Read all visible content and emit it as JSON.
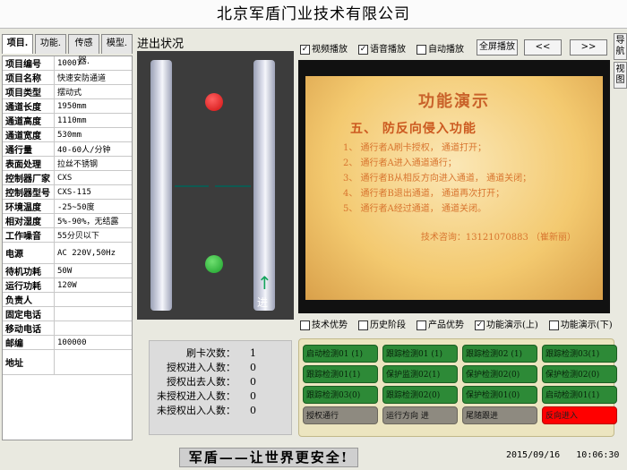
{
  "window": {
    "title": "北京军盾门业技术有限公司"
  },
  "tabs": [
    {
      "label": "项目."
    },
    {
      "label": "功能."
    },
    {
      "label": "传感器."
    },
    {
      "label": "模型."
    }
  ],
  "spec": [
    {
      "key": "项目编号",
      "value": "10007"
    },
    {
      "key": "项目名称",
      "value": "快速安防通道"
    },
    {
      "key": "项目类型",
      "value": "摆动式"
    },
    {
      "key": "通道长度",
      "value": "1950mm"
    },
    {
      "key": "通道高度",
      "value": "1110mm"
    },
    {
      "key": "通道宽度",
      "value": "530mm"
    },
    {
      "key": "通行量",
      "value": "40-60人/分钟"
    },
    {
      "key": "表面处理",
      "value": "拉丝不锈钢"
    },
    {
      "key": "控制器厂家",
      "value": "CXS"
    },
    {
      "key": "控制器型号",
      "value": "CXS-115"
    },
    {
      "key": "环境温度",
      "value": "-25~50度"
    },
    {
      "key": "相对湿度",
      "value": "5%-90%，无结露"
    },
    {
      "key": "工作噪音",
      "value": "55分贝以下"
    },
    {
      "key": "电源",
      "value": "AC 220V,50Hz"
    },
    {
      "key": "待机功耗",
      "value": "50W"
    },
    {
      "key": "运行功耗",
      "value": "120W"
    },
    {
      "key": "负责人",
      "value": ""
    },
    {
      "key": "固定电话",
      "value": ""
    },
    {
      "key": "移动电话",
      "value": ""
    },
    {
      "key": "邮编",
      "value": "100000"
    },
    {
      "key": "地址",
      "value": ""
    }
  ],
  "passage": {
    "label": "进出状况",
    "direction_label": "进",
    "top_light_color": "#d01010",
    "bottom_light_color": "#1aa02a"
  },
  "playback": {
    "video": {
      "label": "视频播放",
      "checked": true
    },
    "voice": {
      "label": "语音播放",
      "checked": true
    },
    "auto": {
      "label": "自动播放",
      "checked": false
    },
    "fullscreen": "全屏播放",
    "prev": "<<",
    "next": ">>"
  },
  "side_nav": {
    "nav": "导航",
    "view": "视图"
  },
  "slide": {
    "title": "功能演示",
    "subtitle": "五、 防反向侵入功能",
    "lines": [
      "1、 通行者A刷卡授权， 通道打开；",
      "2、 通行者A进入通道通行；",
      "3、 通行者B从相反方向进入通道， 通道关闭；",
      "4、 通行者B退出通道， 通道再次打开；",
      "5、 通行者A经过通道， 通道关闭。"
    ],
    "contact": "技术咨询：13121070883 （崔新丽）"
  },
  "modes": [
    {
      "label": "技术优势",
      "checked": false
    },
    {
      "label": "历史阶段",
      "checked": false
    },
    {
      "label": "产品优势",
      "checked": false
    },
    {
      "label": "功能演示(上)",
      "checked": true
    },
    {
      "label": "功能演示(下)",
      "checked": false
    }
  ],
  "counters": [
    {
      "label": "刷卡次数：",
      "value": "1"
    },
    {
      "label": "授权进入人数：",
      "value": "0"
    },
    {
      "label": "授权出去人数：",
      "value": "0"
    },
    {
      "label": "未授权进入人数：",
      "value": "0"
    },
    {
      "label": "未授权出入人数：",
      "value": "0"
    }
  ],
  "status_grid": [
    {
      "label": "启动检测01 (1)",
      "color": "green"
    },
    {
      "label": "跟踪检测01 (1)",
      "color": "green"
    },
    {
      "label": "跟踪检测02 (1)",
      "color": "green"
    },
    {
      "label": "跟踪检测03(1)",
      "color": "green"
    },
    {
      "label": "跟踪检测01(1)",
      "color": "green"
    },
    {
      "label": "保护监测02(1)",
      "color": "green"
    },
    {
      "label": "保护检测02(0)",
      "color": "green"
    },
    {
      "label": "保护检测02(0)",
      "color": "green"
    },
    {
      "label": "跟踪检测03(0)",
      "color": "green"
    },
    {
      "label": "跟踪检测02(0)",
      "color": "green"
    },
    {
      "label": "保护检测01(0)",
      "color": "green"
    },
    {
      "label": "启动检测01(1)",
      "color": "green"
    },
    {
      "label": "授权通行",
      "color": "gray"
    },
    {
      "label": "运行方向  进",
      "color": "gray"
    },
    {
      "label": "尾随跟进",
      "color": "gray"
    },
    {
      "label": "反向进入",
      "color": "red"
    }
  ],
  "footer": {
    "slogan": "军盾——让世界更安全!",
    "date": "2015/09/16",
    "time": "10:06:30"
  }
}
